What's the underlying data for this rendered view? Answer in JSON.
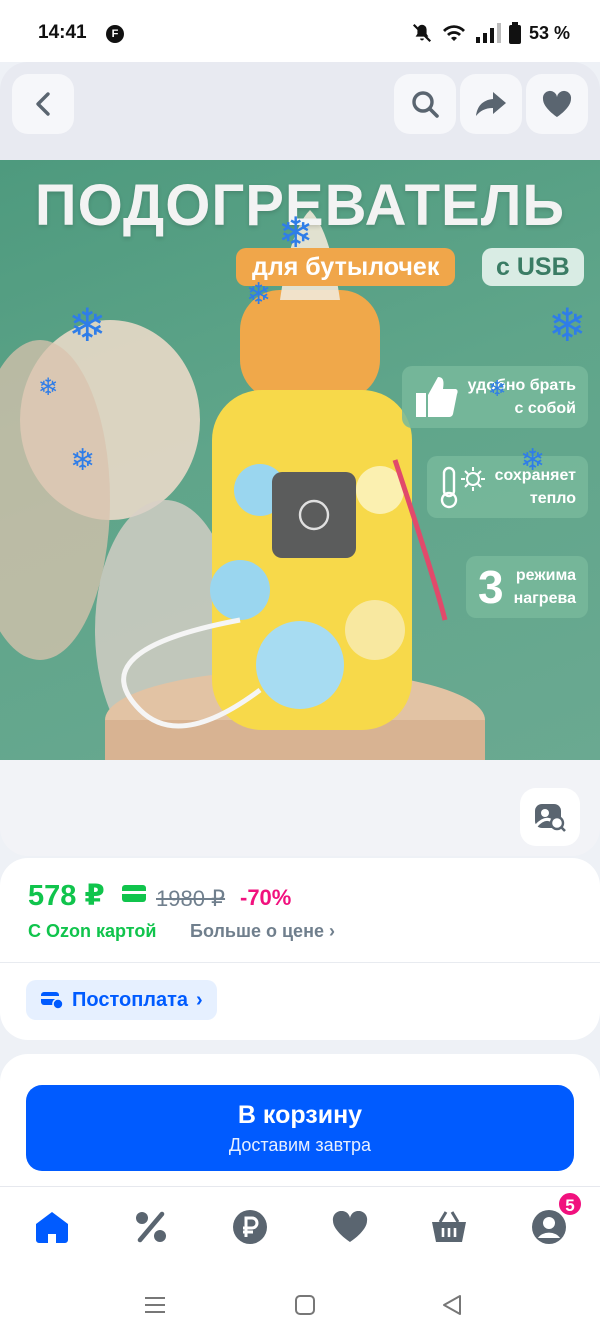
{
  "status_bar": {
    "time": "14:41",
    "notif_badge": "F",
    "battery": "53 %"
  },
  "top_bar": {
    "back_icon": "chevron-left-icon",
    "search_icon": "search-icon",
    "share_icon": "share-icon",
    "favorite_icon": "heart-icon"
  },
  "product_image": {
    "title": "ПОДОГРЕВАТЕЛЬ",
    "subtitle": "для бутылочек",
    "badge": "с USB",
    "features": [
      {
        "text_line1": "удобно брать",
        "text_line2": "с собой",
        "icon": "thumbs-up-icon"
      },
      {
        "text_line1": "сохраняет",
        "text_line2": "тепло",
        "icon": "thermometer-icon"
      },
      {
        "number": "3",
        "text_line1": "режима",
        "text_line2": "нагрева"
      }
    ]
  },
  "image_search_icon": "image-search-icon",
  "price": {
    "current": "578 ₽",
    "old": "1980 ₽",
    "discount": "-70%",
    "ozon_card_label": "С Ozon картой",
    "more_link": "Больше о цене"
  },
  "postpay": {
    "label": "Постоплата"
  },
  "cart_button": {
    "label": "В корзину",
    "sublabel": "Доставим завтра"
  },
  "tab_bar": {
    "items": [
      {
        "name": "home",
        "icon": "home-icon"
      },
      {
        "name": "promo",
        "icon": "percent-icon"
      },
      {
        "name": "ozon-pay",
        "icon": "ruble-icon"
      },
      {
        "name": "favorites",
        "icon": "heart-icon"
      },
      {
        "name": "cart",
        "icon": "basket-icon"
      },
      {
        "name": "profile",
        "icon": "profile-icon",
        "badge": "5"
      }
    ]
  },
  "colors": {
    "accent": "#005bff",
    "price_green": "#10c44c",
    "discount_pink": "#f1117e"
  }
}
